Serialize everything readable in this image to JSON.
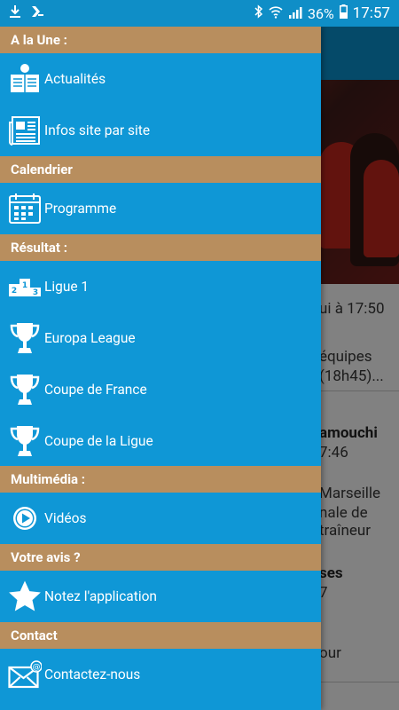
{
  "status_bar": {
    "time": "17:57",
    "battery": "36%"
  },
  "background": {
    "lines": [
      {
        "text": "ui à 17:50",
        "bold": false
      },
      {
        "text": "équipes",
        "bold": false
      },
      {
        "text": "(18h45)...",
        "bold": false
      },
      {
        "text": "amouchi",
        "bold": true
      },
      {
        "text": "7:46",
        "bold": false
      },
      {
        "text": "Marseille",
        "bold": false
      },
      {
        "text": "nale de",
        "bold": false
      },
      {
        "text": "traîneur",
        "bold": false
      },
      {
        "text": "ses",
        "bold": true
      },
      {
        "text": "7",
        "bold": false
      },
      {
        "text": "our",
        "bold": false
      }
    ]
  },
  "drawer": {
    "sections": [
      {
        "title": "A la Une :",
        "items": [
          {
            "label": "Actualités",
            "icon": "newspaper-reader-icon"
          },
          {
            "label": "Infos site par site",
            "icon": "newspaper-icon"
          }
        ]
      },
      {
        "title": "Calendrier",
        "items": [
          {
            "label": "Programme",
            "icon": "calendar-icon"
          }
        ]
      },
      {
        "title": "Résultat :",
        "items": [
          {
            "label": "Ligue 1",
            "icon": "podium-icon"
          },
          {
            "label": "Europa League",
            "icon": "trophy-icon"
          },
          {
            "label": "Coupe de France",
            "icon": "trophy-icon"
          },
          {
            "label": "Coupe de la Ligue",
            "icon": "trophy-icon"
          }
        ]
      },
      {
        "title": "Multimédia :",
        "items": [
          {
            "label": "Vidéos",
            "icon": "play-icon"
          }
        ]
      },
      {
        "title": "Votre avis ?",
        "items": [
          {
            "label": "Notez l'application",
            "icon": "star-icon"
          }
        ]
      },
      {
        "title": "Contact",
        "items": [
          {
            "label": "Contactez-nous",
            "icon": "mail-icon"
          }
        ]
      }
    ]
  }
}
